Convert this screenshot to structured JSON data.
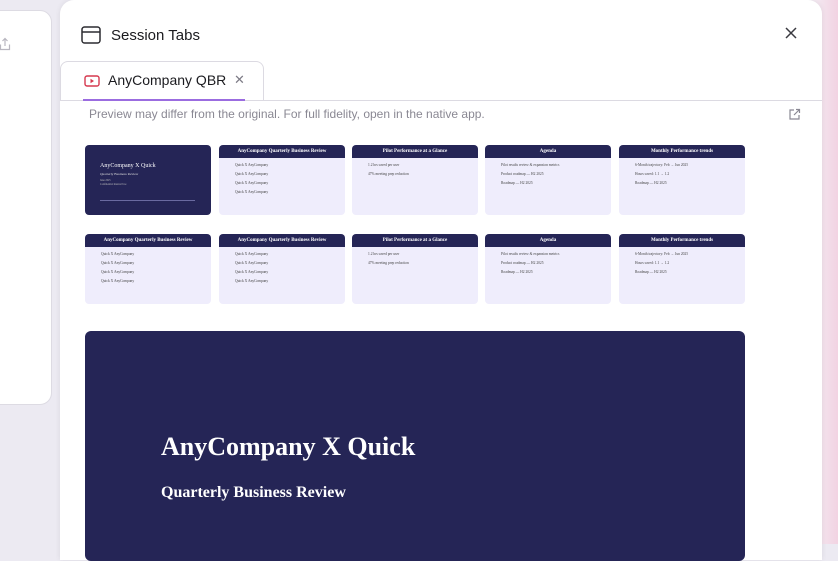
{
  "dialog": {
    "title": "Session Tabs"
  },
  "tab": {
    "label": "AnyCompany QBR"
  },
  "notice": "Preview may differ from the original. For full fidelity, open in the native app.",
  "thumbnails": [
    {
      "cover": true,
      "title": "AnyCompany X Quick",
      "subtitle": "Quarterly Business Review",
      "meta1": "June 2025",
      "meta2": "Confidential Internal Use"
    },
    {
      "heading": "AnyCompany Quarterly Business Review",
      "lines": [
        "Quick X AnyCompany",
        "Quick X AnyCompany",
        "Quick X AnyCompany",
        "Quick X AnyCompany"
      ]
    },
    {
      "heading": "Pilot Performance at a Glance",
      "lines": [
        "1.2 hrs saved per user",
        "47% meeting prep reduction"
      ]
    },
    {
      "heading": "Agenda",
      "lines": [
        "Pilot results review & expansion metrics",
        "Product roadmap — H2 2025",
        "Roadmap — H2 2025"
      ]
    },
    {
      "heading": "Monthly Performance trends",
      "lines": [
        "6-Month trajectory: Feb → Jun 2025",
        "Hours saved: 1.1 → 1.2",
        "Roadmap — H2 2025"
      ]
    },
    {
      "heading": "AnyCompany Quarterly Business Review",
      "lines": [
        "Quick X AnyCompany",
        "Quick X AnyCompany",
        "Quick X AnyCompany",
        "Quick X AnyCompany"
      ]
    },
    {
      "heading": "AnyCompany Quarterly Business Review",
      "lines": [
        "Quick X AnyCompany",
        "Quick X AnyCompany",
        "Quick X AnyCompany",
        "Quick X AnyCompany"
      ]
    },
    {
      "heading": "Pilot Performance at a Glance",
      "lines": [
        "1.2 hrs saved per user",
        "47% meeting prep reduction"
      ]
    },
    {
      "heading": "Agenda",
      "lines": [
        "Pilot results review & expansion metrics",
        "Product roadmap — H2 2025",
        "Roadmap — H2 2025"
      ]
    },
    {
      "heading": "Monthly Performance trends",
      "lines": [
        "6-Month trajectory: Feb → Jun 2025",
        "Hours saved: 1.1 → 1.2",
        "Roadmap — H2 2025"
      ]
    }
  ],
  "slide": {
    "title": "AnyCompany X Quick",
    "subtitle": "Quarterly Business Review"
  },
  "icons": {
    "window": "browser-window-icon",
    "close": "close-icon",
    "tab": "video-icon",
    "external": "external-link-icon",
    "share": "share-icon"
  },
  "colors": {
    "accent": "#9b6ce0",
    "slide_bg": "#252556",
    "thumb_bg": "#efedfc",
    "tab_icon": "#d6394f"
  }
}
